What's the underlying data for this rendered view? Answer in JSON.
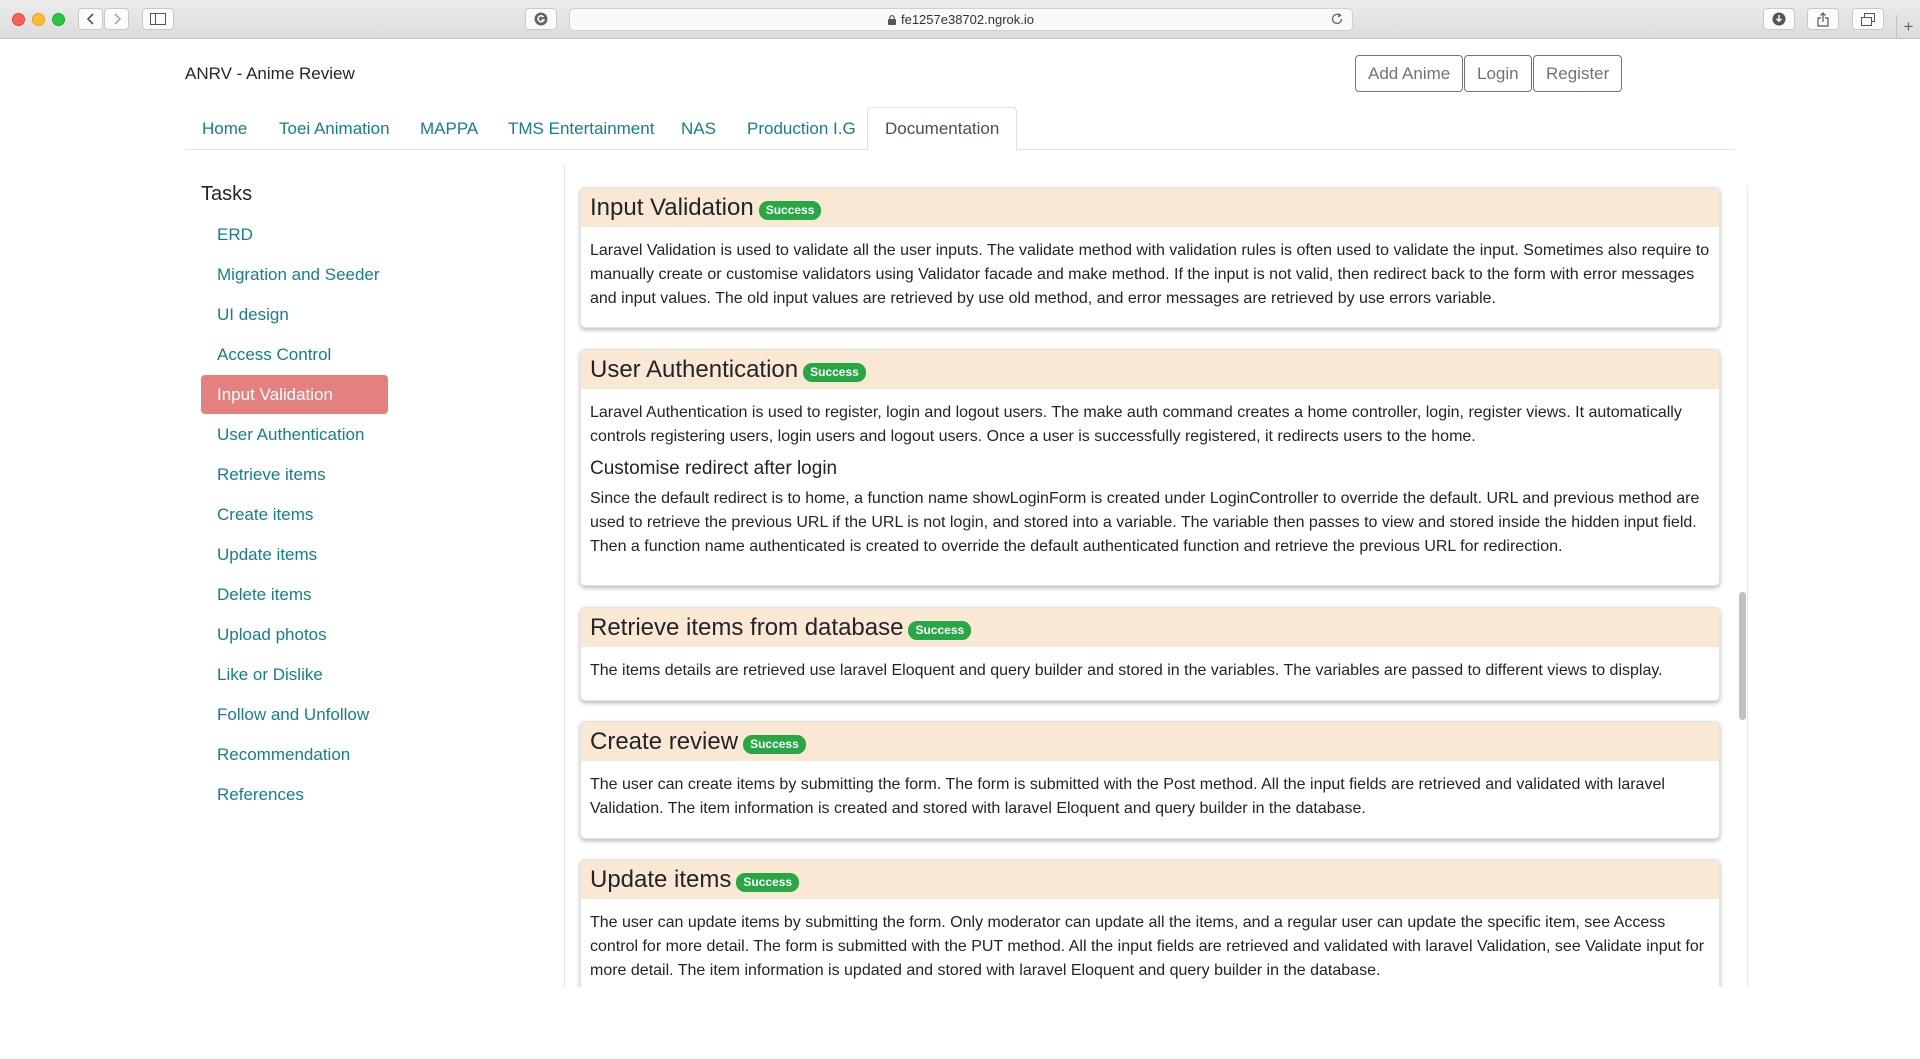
{
  "browser": {
    "url": "fe1257e38702.ngrok.io"
  },
  "header": {
    "brand": "ANRV - Anime Review",
    "buttons": {
      "add_anime": "Add Anime",
      "login": "Login",
      "register": "Register"
    }
  },
  "nav": {
    "tabs": [
      "Home",
      "Toei Animation",
      "MAPPA",
      "TMS Entertainment",
      "NAS",
      "Production I.G",
      "Documentation"
    ],
    "active": "Documentation"
  },
  "sidebar": {
    "title": "Tasks",
    "items": [
      "ERD",
      "Migration and Seeder",
      "UI design",
      "Access Control",
      "Input Validation",
      "User Authentication",
      "Retrieve items",
      "Create items",
      "Update items",
      "Delete items",
      "Upload photos",
      "Like or Dislike",
      "Follow and Unfollow",
      "Recommendation",
      "References"
    ],
    "active": "Input Validation"
  },
  "cards": [
    {
      "title": "Input Validation",
      "badge": "Success",
      "body": "Laravel Validation is used to validate all the user inputs. The validate method with validation rules is often used to validate the input. Sometimes also require to manually create or customise validators using Validator facade and make method. If the input is not valid, then redirect back to the form with error messages and input values. The old input values are retrieved by use old method, and error messages are retrieved by use errors variable."
    },
    {
      "title": "User Authentication",
      "badge": "Success",
      "body": "Laravel Authentication is used to register, login and logout users. The make auth command creates a home controller, login, register views. It automatically controls registering users, login users and logout users. Once a user is successfully registered, it redirects users to the home.",
      "subheading": "Customise redirect after login",
      "subbody": "Since the default redirect is to home, a function name showLoginForm is created under LoginController to override the default. URL and previous method are used to retrieve the previous URL if the URL is not login, and stored into a variable. The variable then passes to view and stored inside the hidden input field. Then a function name authenticated is created to override the default authenticated function and retrieve the previous URL for redirection."
    },
    {
      "title": "Retrieve items from database",
      "badge": "Success",
      "body": "The items details are retrieved use laravel Eloquent and query builder and stored in the variables. The variables are passed to different views to display."
    },
    {
      "title": "Create review",
      "badge": "Success",
      "body": "The user can create items by submitting the form. The form is submitted with the Post method. All the input fields are retrieved and validated with laravel Validation. The item information is created and stored with laravel Eloquent and query builder in the database."
    },
    {
      "title": "Update items",
      "badge": "Success",
      "body": "The user can update items by submitting the form. Only moderator can update all the items, and a regular user can update the specific item, see Access control for more detail. The form is submitted with the PUT method. All the input fields are retrieved and validated with laravel Validation, see Validate input for more detail. The item information is updated and stored with laravel Eloquent and query builder in the database."
    }
  ]
}
